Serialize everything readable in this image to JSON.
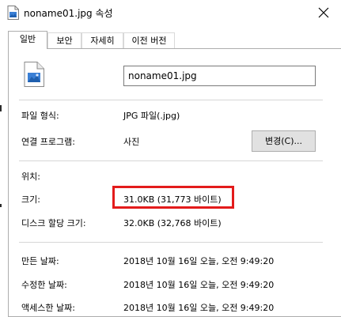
{
  "window": {
    "title": "noname01.jpg 속성"
  },
  "tabs": [
    {
      "label": "일반",
      "active": true
    },
    {
      "label": "보안",
      "active": false
    },
    {
      "label": "자세히",
      "active": false
    },
    {
      "label": "이전 버전",
      "active": false
    }
  ],
  "general": {
    "file_name": "noname01.jpg",
    "file_type_label": "파일 형식:",
    "file_type_value": "JPG 파일(.jpg)",
    "open_with_label": "연결 프로그램:",
    "open_with_value": "사진",
    "change_button": "변경(C)...",
    "location_label": "위치:",
    "size_label": "크기:",
    "size_value": "31.0KB (31,773 바이트)",
    "size_on_disk_label": "디스크 할당 크기:",
    "size_on_disk_value": "32.0KB (32,768 바이트)",
    "created_label": "만든 날짜:",
    "created_value": "2018년 10월 16일 오늘, 오전 9:49:20",
    "modified_label": "수정한 날짜:",
    "modified_value": "2018년 10월 16일 오늘, 오전 9:49:20",
    "accessed_label": "액세스한 날짜:",
    "accessed_value": "2018년 10월 16일 오늘, 오전 9:49:20"
  },
  "colors": {
    "highlight": "#e31b1b",
    "icon_blue": "#3a7fd5"
  },
  "icons": {
    "file": "image-file-icon",
    "close": "close-icon"
  }
}
